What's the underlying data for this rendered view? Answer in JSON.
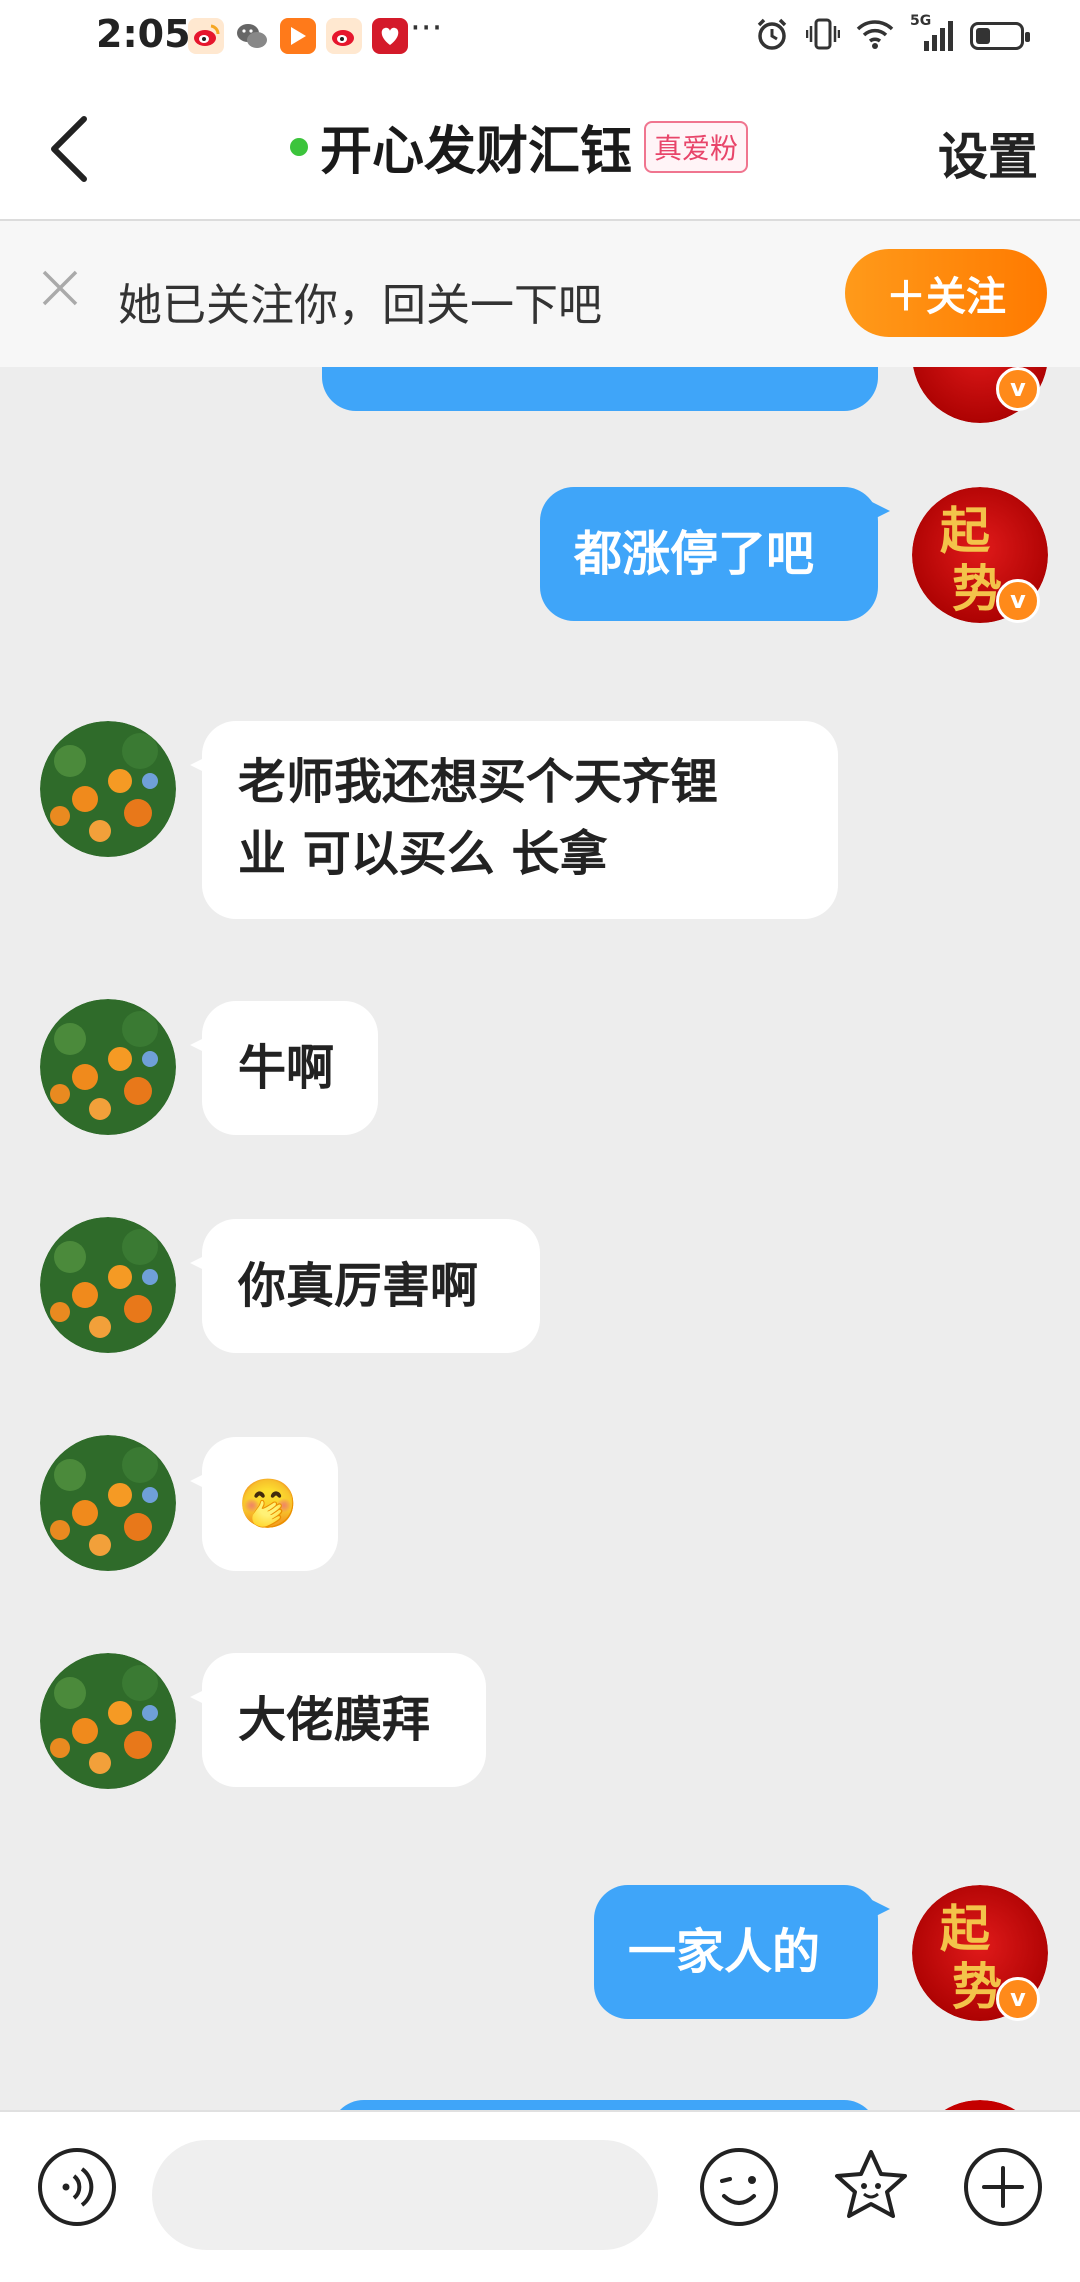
{
  "status_bar": {
    "time": "2:05",
    "overflow": "···",
    "network": "5G",
    "app_icons": [
      "weibo-icon",
      "wechat-icon",
      "video-app-icon",
      "weibo-icon",
      "red-app-icon"
    ]
  },
  "header": {
    "back_icon": "chevron-left-icon",
    "title": "开心发财汇钰",
    "badge": "真爱粉",
    "settings_label": "设置",
    "online": true
  },
  "follow_banner": {
    "text": "她已关注你，回关一下吧",
    "button_label": "＋关注"
  },
  "avatars": {
    "me": {
      "line1": "起",
      "line2": "势"
    },
    "verified_mark": "v"
  },
  "messages": [
    {
      "sender": "me",
      "text": "",
      "partial": true
    },
    {
      "sender": "me",
      "text": "都涨停了吧"
    },
    {
      "sender": "other",
      "line1": "老师我还想买个天齐锂",
      "line2": "业 可以买么 长拿"
    },
    {
      "sender": "other",
      "text": "牛啊"
    },
    {
      "sender": "other",
      "text": "你真厉害啊"
    },
    {
      "sender": "other",
      "emoji": "🤭"
    },
    {
      "sender": "other",
      "text": "大佬膜拜"
    },
    {
      "sender": "me",
      "text": "一家人的"
    },
    {
      "sender": "me",
      "text": "",
      "partial": true
    }
  ],
  "composer": {
    "placeholder": "",
    "icons": [
      "voice-icon",
      "emoji-face-icon",
      "sticker-icon",
      "plus-icon"
    ]
  },
  "colors": {
    "my_bubble": "#3fa5f9",
    "follow_button": "#ff8a00",
    "background": "#ededed"
  }
}
